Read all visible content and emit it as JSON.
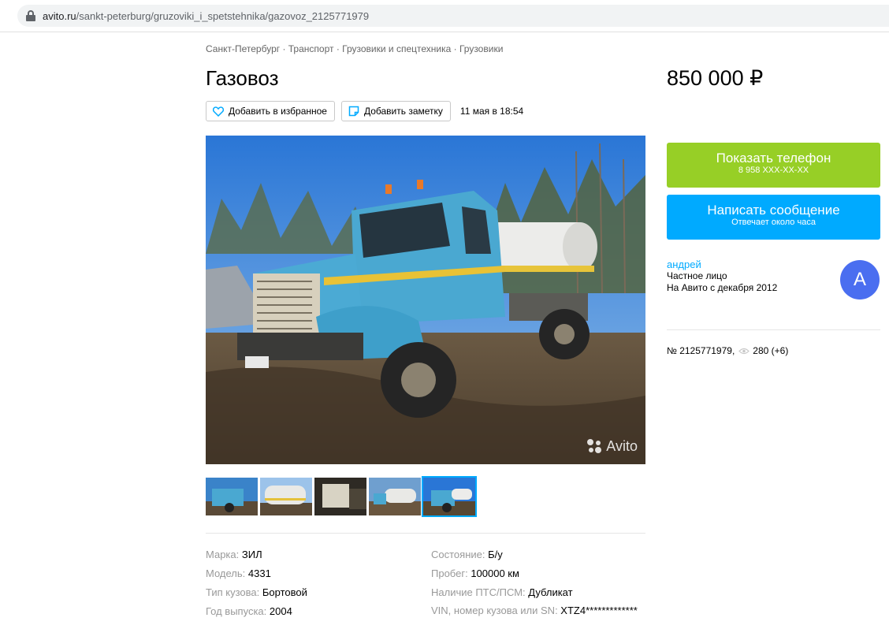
{
  "browser": {
    "domain": "avito.ru",
    "path": "/sankt-peterburg/gruzoviki_i_spetstehnika/gazovoz_2125771979"
  },
  "breadcrumb": "Санкт-Петербург · Транспорт · Грузовики и спецтехника · Грузовики",
  "listing": {
    "title": "Газовоз",
    "price": "850 000 ₽",
    "favorite_label": "Добавить в избранное",
    "note_label": "Добавить заметку",
    "date": "11 мая в 18:54",
    "watermark": "Avito"
  },
  "contact": {
    "phone_label": "Показать телефон",
    "phone_masked": "8 958 XXX-XX-XX",
    "message_label": "Написать сообщение",
    "message_sub": "Отвечает около часа"
  },
  "seller": {
    "name": "андрей",
    "type": "Частное лицо",
    "since": "На Авито с декабря 2012",
    "avatar_letter": "А"
  },
  "stats": {
    "id": "№ 2125771979,",
    "views": "280 (+6)"
  },
  "params": [
    {
      "key": "Марка: ",
      "value": "ЗИЛ"
    },
    {
      "key": "Состояние: ",
      "value": "Б/у"
    },
    {
      "key": "Модель: ",
      "value": "4331"
    },
    {
      "key": "Пробег: ",
      "value": "100000 км"
    },
    {
      "key": "Тип кузова: ",
      "value": "Бортовой"
    },
    {
      "key": "Наличие ПТС/ПСМ: ",
      "value": "Дубликат"
    },
    {
      "key": "Год выпуска: ",
      "value": "2004"
    },
    {
      "key": "VIN, номер кузова или SN: ",
      "value": "XTZ4*************"
    }
  ],
  "colors": {
    "phone_button": "#97cf26",
    "message_button": "#00aaff",
    "link": "#00aaff",
    "avatar": "#4a6ef0"
  }
}
